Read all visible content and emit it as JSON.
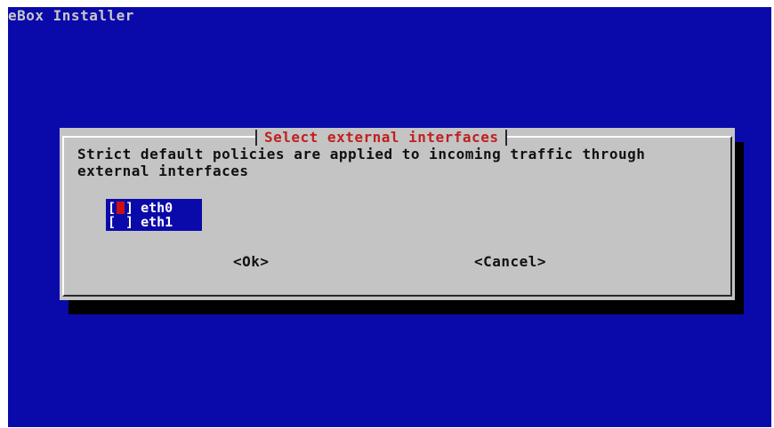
{
  "app": {
    "backtitle": "eBox Installer"
  },
  "dialog": {
    "title": "Select external interfaces",
    "prompt_line1": "Strict default policies are applied to incoming traffic through",
    "prompt_line2": "external interfaces",
    "items": [
      {
        "bracket_open": "[",
        "bracket_close": "]",
        "name": "eth0",
        "checked": false,
        "focused": true
      },
      {
        "bracket_open": "[",
        "bracket_close": "]",
        "name": "eth1",
        "checked": false,
        "focused": false
      }
    ],
    "ok_label": "<Ok>",
    "cancel_label": "<Cancel>"
  },
  "colors": {
    "background": "#0a0aaa",
    "dialog": "#c4c4c4",
    "title": "#c02020",
    "cursor": "#cc1010"
  }
}
